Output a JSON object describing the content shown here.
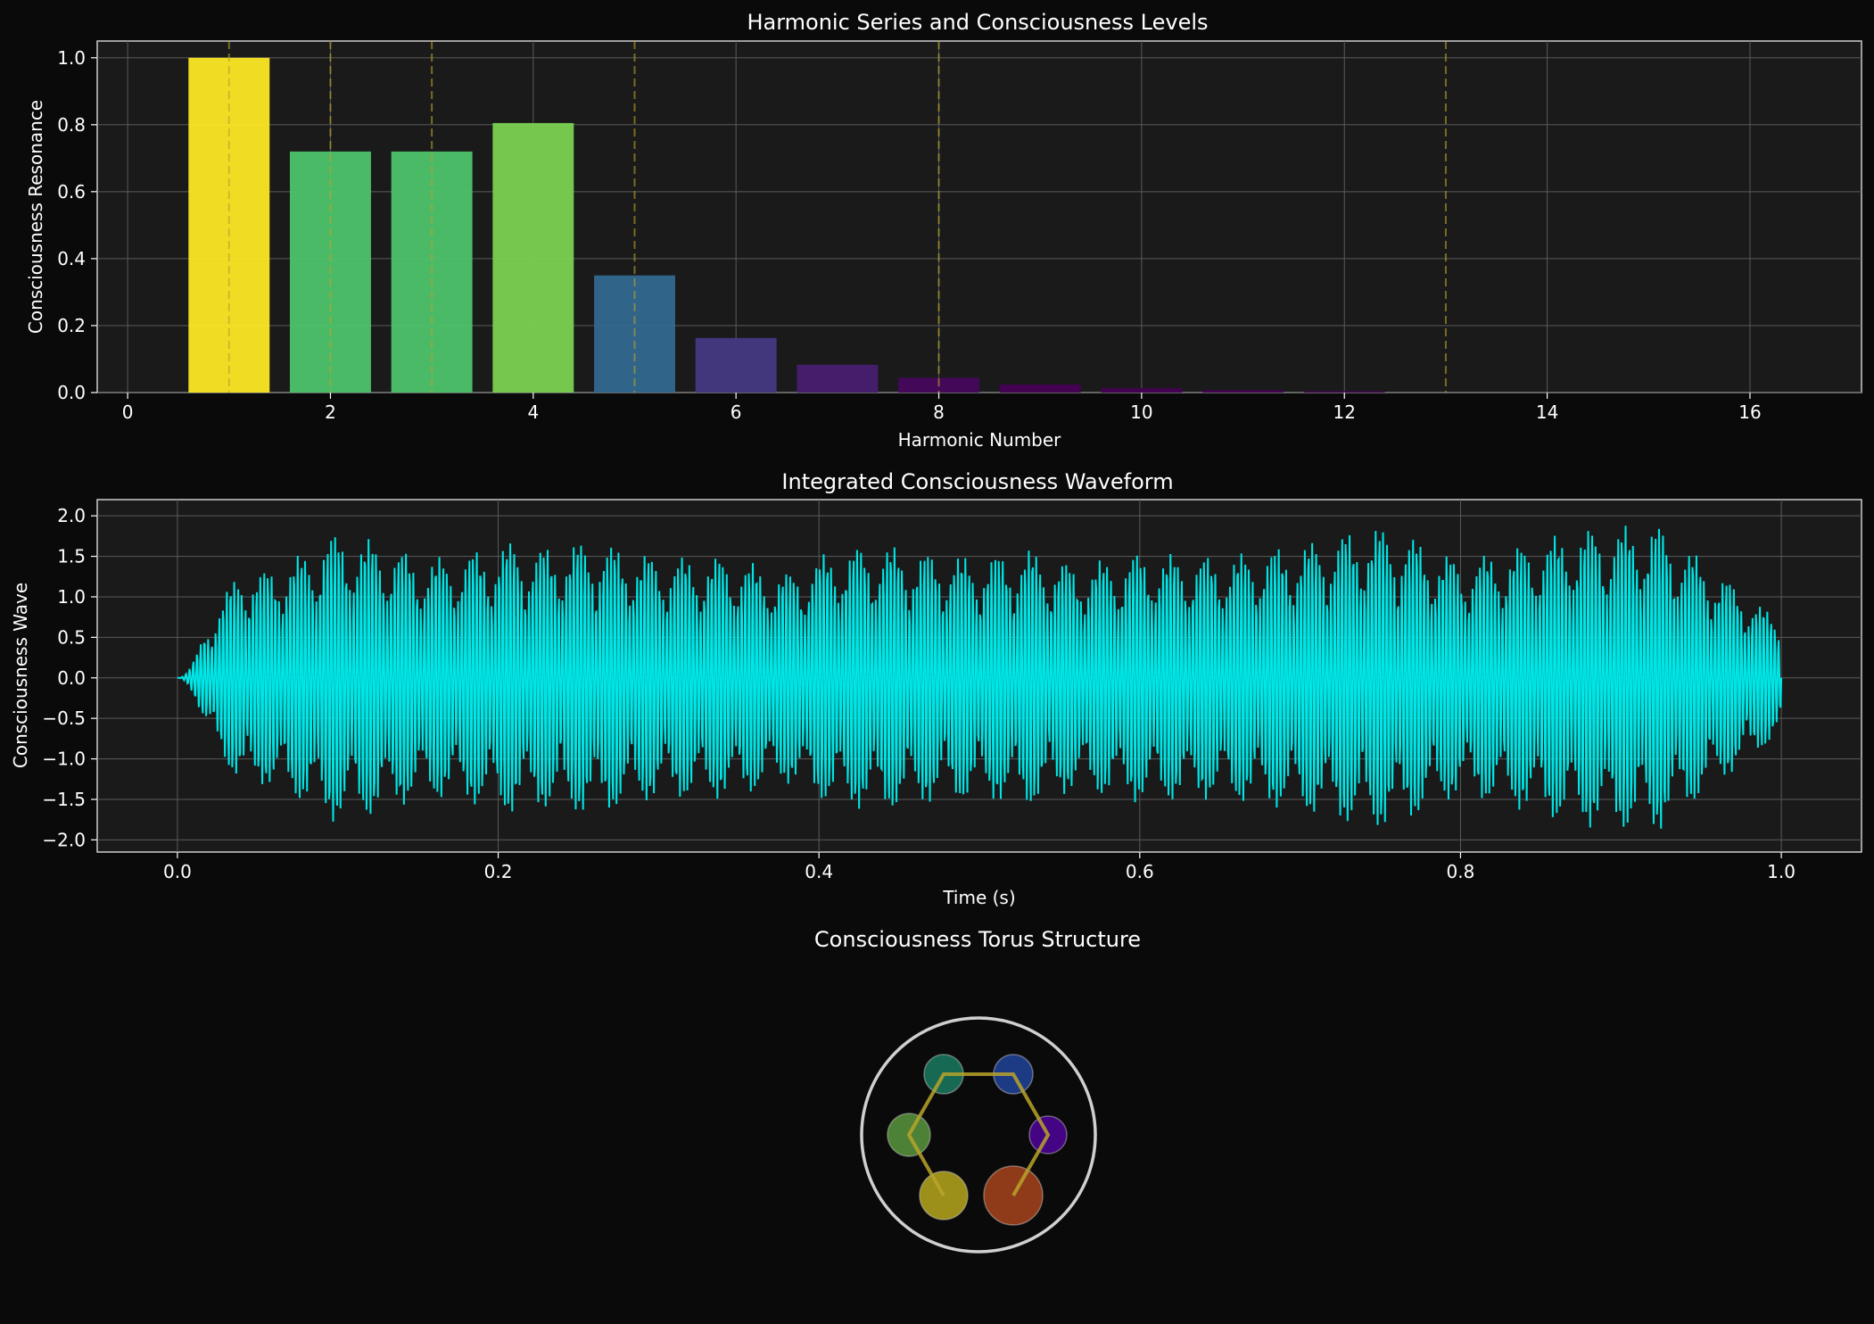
{
  "chart_data": [
    {
      "type": "bar",
      "title": "Harmonic Series and Consciousness Levels",
      "xlabel": "Harmonic Number",
      "ylabel": "Consciousness Resonance",
      "xlim": [
        -0.3,
        17.1
      ],
      "ylim": [
        0,
        1.05
      ],
      "grid": true,
      "x": [
        1,
        2,
        3,
        4,
        5,
        6,
        7,
        8,
        9,
        10,
        11,
        12
      ],
      "values": [
        1.0,
        0.72,
        0.72,
        0.805,
        0.35,
        0.163,
        0.083,
        0.044,
        0.024,
        0.013,
        0.007,
        0.004
      ],
      "bar_colors": [
        "#fde725",
        "#4ec36b",
        "#4ec36b",
        "#7ad151",
        "#31688e",
        "#443983",
        "#481f70",
        "#46085c",
        "#440154",
        "#440154",
        "#440154",
        "#440154"
      ],
      "xticks": [
        "0",
        "2",
        "4",
        "6",
        "8",
        "10",
        "12",
        "14",
        "16"
      ],
      "yticks": [
        "0.0",
        "0.2",
        "0.4",
        "0.6",
        "0.8",
        "1.0"
      ],
      "reference_lines": {
        "x": [
          1,
          2,
          3,
          5,
          8,
          13
        ],
        "color": "#b8a42a",
        "style": "dashed"
      }
    },
    {
      "type": "line",
      "title": "Integrated Consciousness Waveform",
      "xlabel": "Time (s)",
      "ylabel": "Consciousness Wave",
      "xlim": [
        -0.05,
        1.05
      ],
      "ylim": [
        -2.15,
        2.2
      ],
      "grid": true,
      "series": [
        {
          "color": "#00e5e5",
          "x": [
            0.0,
            0.04,
            0.05,
            0.085,
            0.09,
            0.125,
            0.15,
            0.17,
            0.21,
            0.22,
            0.255,
            0.26,
            0.29,
            0.3,
            0.345,
            0.38,
            0.41,
            0.44,
            0.47,
            0.5,
            0.53,
            0.56,
            0.6,
            0.65,
            0.71,
            0.745,
            0.77,
            0.8,
            0.83,
            0.875,
            0.88,
            0.915,
            0.92,
            0.955,
            1.0
          ],
          "y": [
            0.0,
            1.4,
            -1.3,
            1.6,
            -1.8,
            1.7,
            -1.5,
            1.5,
            -1.7,
            1.6,
            1.7,
            -1.7,
            1.55,
            -1.5,
            1.5,
            -1.3,
            1.6,
            -1.65,
            1.55,
            -1.5,
            1.6,
            -1.4,
            1.55,
            -1.5,
            1.7,
            1.9,
            -1.75,
            1.45,
            -1.6,
            1.85,
            -1.85,
            1.9,
            -1.95,
            1.4,
            -0.7
          ]
        }
      ],
      "xticks": [
        "0.0",
        "0.2",
        "0.4",
        "0.6",
        "0.8",
        "1.0"
      ],
      "yticks": [
        "2.0",
        "1.5",
        "1.0",
        "0.5",
        "0.0",
        "−0.5",
        "−1.0",
        "−1.5",
        "−2.0"
      ]
    },
    {
      "type": "diagram",
      "title": "Consciousness Torus Structure",
      "ring_color": "#d0d0d0",
      "path_color": "#b8a42a",
      "nodes": [
        {
          "color": "#fde725"
        },
        {
          "color": "#7ad151"
        },
        {
          "color": "#22a884"
        },
        {
          "color": "#2a5bd7"
        },
        {
          "color": "#6a00d5"
        },
        {
          "color": "#e85c23"
        }
      ]
    }
  ]
}
